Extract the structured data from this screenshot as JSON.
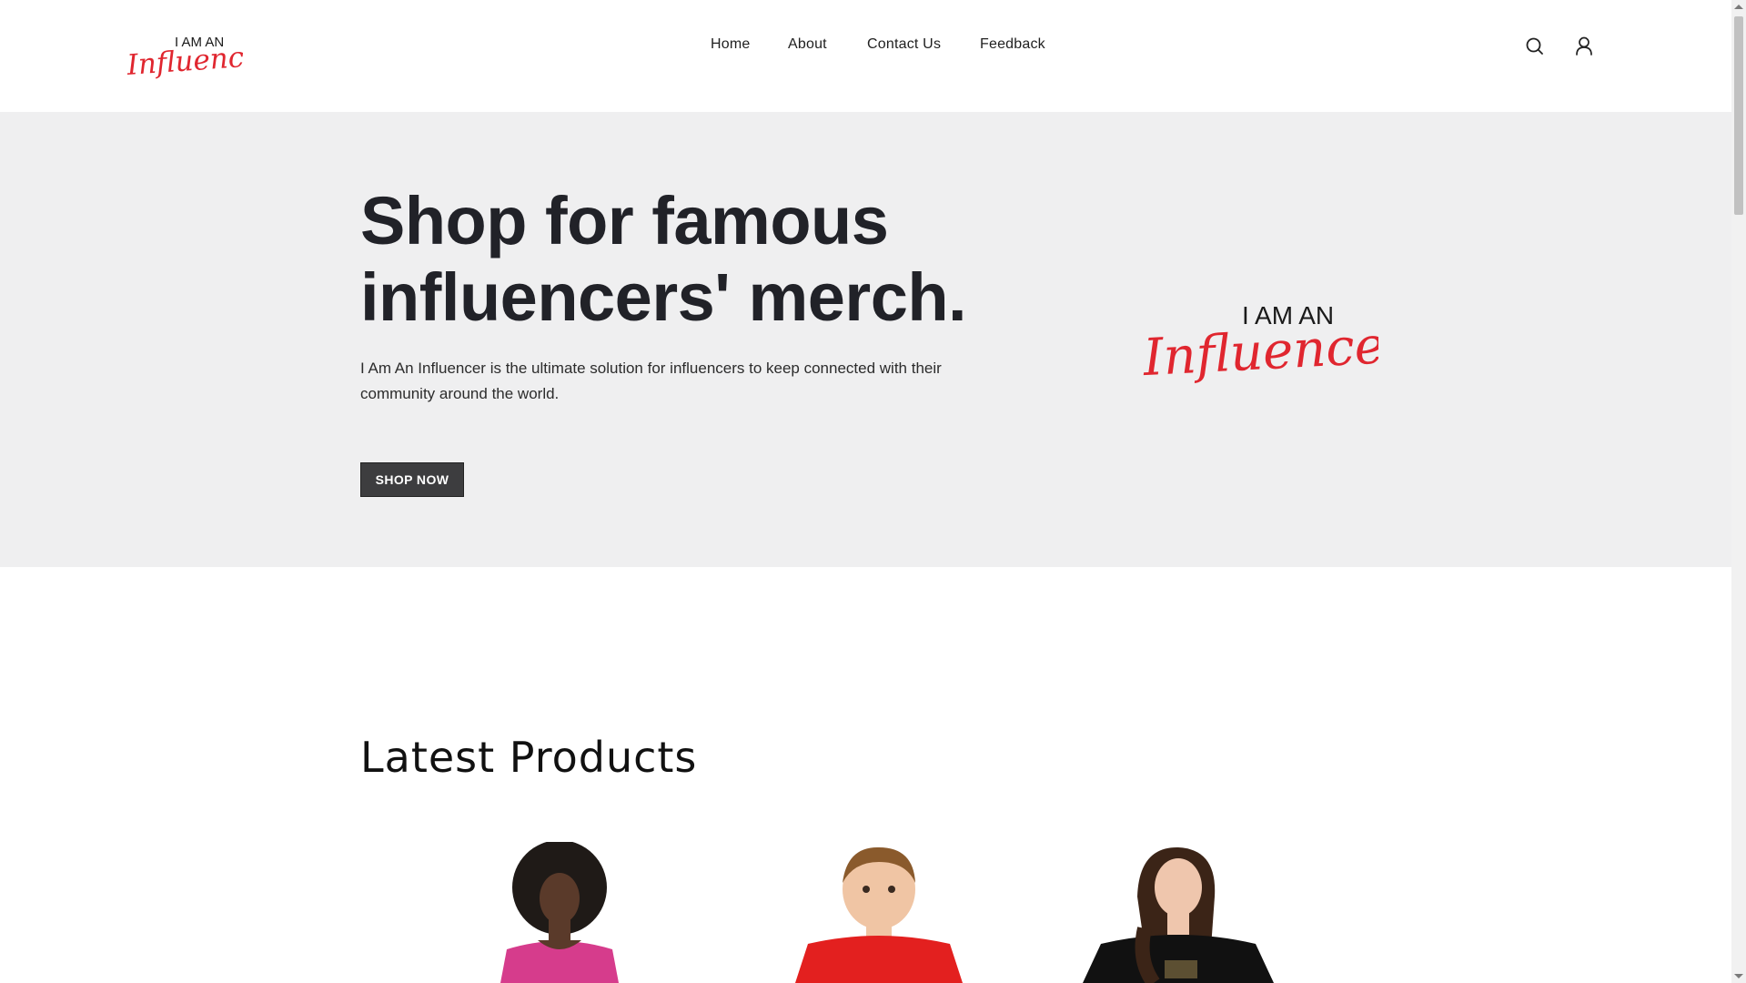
{
  "brand": {
    "logo_top": "I AM AN",
    "logo_script": "Influencer",
    "accent_color": "#e0262f"
  },
  "nav": {
    "items": [
      {
        "label": "Home"
      },
      {
        "label": "About"
      },
      {
        "label": "Contact Us"
      },
      {
        "label": "Feedback"
      }
    ],
    "icons": [
      "search-icon",
      "user-icon"
    ]
  },
  "hero": {
    "title": "Shop for famous influencers' merch.",
    "description": "I Am An Influencer is the ultimate solution for influencers to keep connected with their community around the world.",
    "cta_label": "SHOP NOW",
    "background": "#efeff0"
  },
  "latest": {
    "title": "Latest Products",
    "products": [
      {
        "image": "woman in pink t-shirt"
      },
      {
        "image": "boy in red t-shirt"
      },
      {
        "image": "woman in black t-shirt"
      }
    ]
  }
}
